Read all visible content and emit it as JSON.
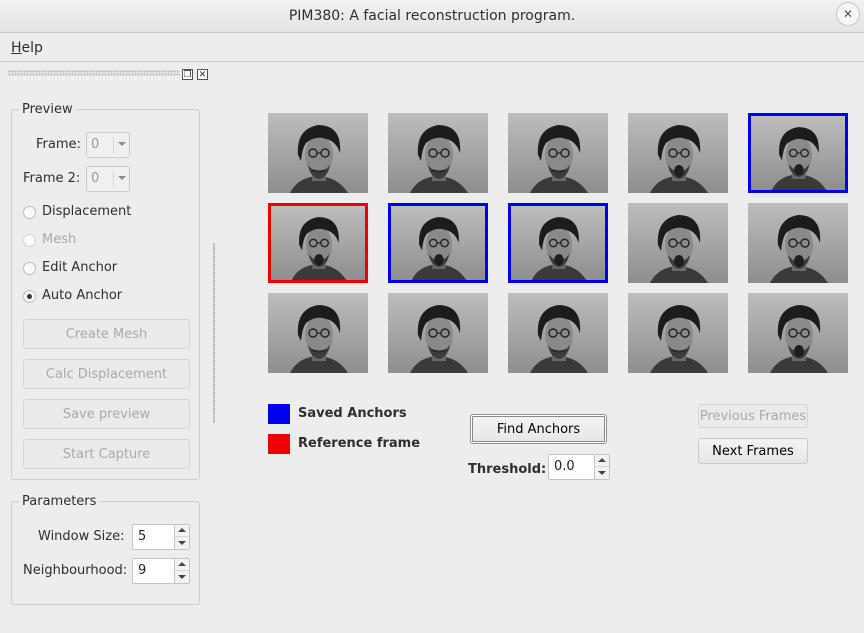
{
  "window": {
    "title": "PIM380: A facial reconstruction program."
  },
  "menu": {
    "help": "Help",
    "help_rest": "elp",
    "help_mnemonic": "H"
  },
  "preview": {
    "title": "Preview",
    "frame_label": "Frame:",
    "frame_value": "0",
    "frame2_label": "Frame 2:",
    "frame2_value": "0",
    "modes": [
      {
        "label": "Displacement",
        "checked": false,
        "enabled": true
      },
      {
        "label": "Mesh",
        "checked": false,
        "enabled": false
      },
      {
        "label": "Edit Anchor",
        "checked": false,
        "enabled": true
      },
      {
        "label": "Auto Anchor",
        "checked": true,
        "enabled": true
      }
    ],
    "buttons": {
      "create_mesh": "Create Mesh",
      "calc_displacement": "Calc Displacement",
      "save_preview": "Save preview",
      "start_capture": "Start Capture"
    }
  },
  "parameters": {
    "title": "Parameters",
    "window_size_label": "Window Size:",
    "window_size_value": "5",
    "neighbourhood_label": "Neighbourhood:",
    "neighbourhood_value": "9"
  },
  "frames": [
    {
      "state": "normal",
      "mouth": "closed"
    },
    {
      "state": "normal",
      "mouth": "closed"
    },
    {
      "state": "normal",
      "mouth": "closed"
    },
    {
      "state": "normal",
      "mouth": "open"
    },
    {
      "state": "saved",
      "mouth": "open"
    },
    {
      "state": "reference",
      "mouth": "open"
    },
    {
      "state": "saved",
      "mouth": "open"
    },
    {
      "state": "saved",
      "mouth": "open"
    },
    {
      "state": "normal",
      "mouth": "open"
    },
    {
      "state": "normal",
      "mouth": "open"
    },
    {
      "state": "normal",
      "mouth": "closed"
    },
    {
      "state": "normal",
      "mouth": "closed"
    },
    {
      "state": "normal",
      "mouth": "closed"
    },
    {
      "state": "normal",
      "mouth": "closed"
    },
    {
      "state": "normal",
      "mouth": "open"
    }
  ],
  "legend": {
    "saved_anchors": "Saved Anchors",
    "saved_color": "#0000ee",
    "reference_frame": "Reference frame",
    "reference_color": "#ee0000"
  },
  "controls": {
    "find_anchors": "Find Anchors",
    "threshold_label": "Threshold:",
    "threshold_value": "0.0",
    "previous_frames": "Previous Frames",
    "next_frames": "Next Frames"
  }
}
